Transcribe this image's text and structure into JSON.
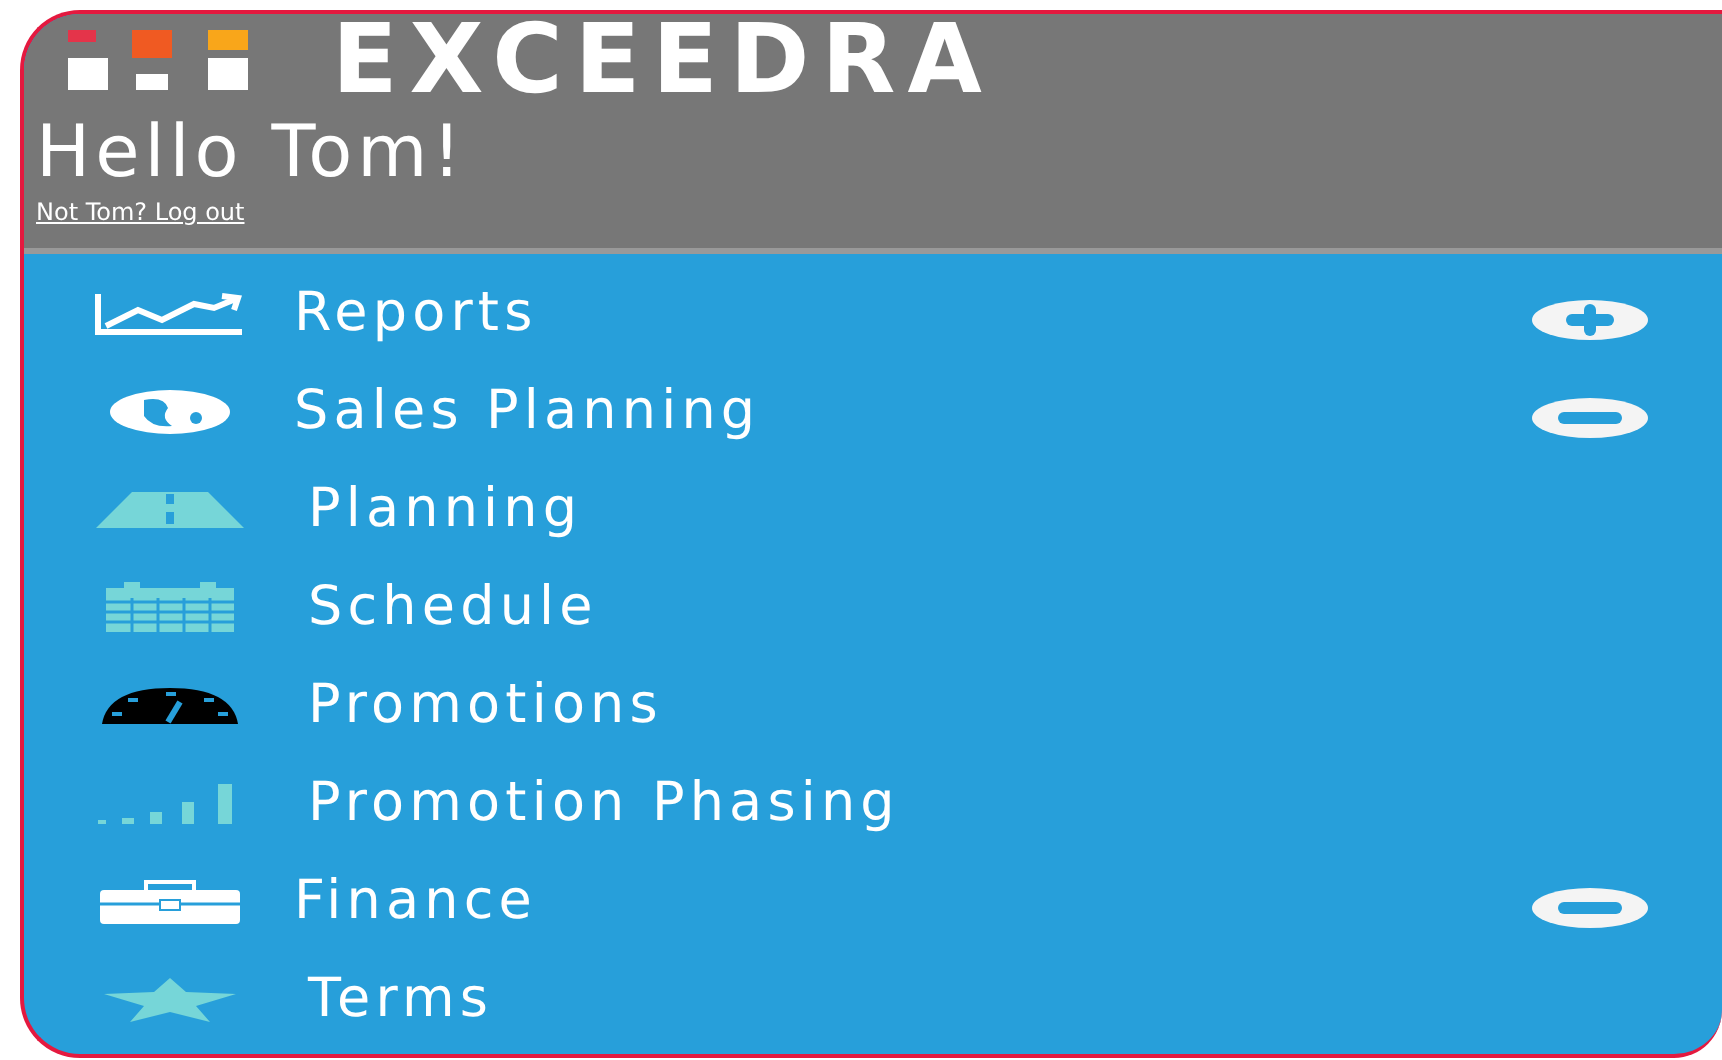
{
  "header": {
    "brand": "EXCEEDRA",
    "greeting": "Hello Tom!",
    "logout_link": "Not Tom? Log out"
  },
  "menu": [
    {
      "label": "Reports",
      "expanded": false
    },
    {
      "label": "Sales Planning",
      "expanded": true,
      "children": [
        {
          "label": "Planning"
        },
        {
          "label": "Schedule"
        },
        {
          "label": "Promotions"
        },
        {
          "label": "Promotion Phasing"
        }
      ]
    },
    {
      "label": "Finance",
      "expanded": true,
      "children": [
        {
          "label": "Terms"
        }
      ]
    }
  ]
}
